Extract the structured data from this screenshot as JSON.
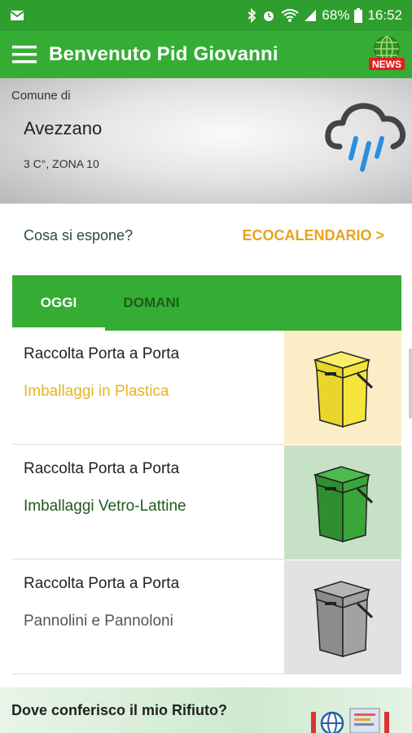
{
  "status_bar": {
    "battery": "68%",
    "time": "16:52",
    "left_icon": "mail-icon",
    "right_icons": [
      "bluetooth-icon",
      "alarm-icon",
      "wifi-icon",
      "signal-icon",
      "battery-icon"
    ]
  },
  "app_bar": {
    "title": "Benvenuto Pid Giovanni",
    "news_badge": "NEWS"
  },
  "weather": {
    "comune_label": "Comune di",
    "city": "Avezzano",
    "zone": "3 C°, ZONA 10",
    "icon": "rain-cloud-icon"
  },
  "links": {
    "question": "Cosa si espone?",
    "calendar": "ECOCALENDARIO >"
  },
  "tabs": [
    {
      "label": "OGGI",
      "active": true
    },
    {
      "label": "DOMANI",
      "active": false
    }
  ],
  "collections": [
    {
      "title": "Raccolta Porta a Porta",
      "type": "Imballaggi in Plastica",
      "type_color": "#e6b422",
      "bin_color": "#f2e33a",
      "bin_bg": "#fbeec7"
    },
    {
      "title": "Raccolta Porta a Porta",
      "type": "Imballaggi Vetro-Lattine",
      "type_color": "#1f5a1f",
      "bin_color": "#35a035",
      "bin_bg": "#c7e1c7"
    },
    {
      "title": "Raccolta Porta a Porta",
      "type": "Pannolini e Pannoloni",
      "type_color": "#555555",
      "bin_color": "#9a9a9a",
      "bin_bg": "#e2e2e2"
    }
  ],
  "bottom": {
    "title": "Dove conferisco il mio Rifiuto?"
  },
  "colors": {
    "primary": "#35ad35",
    "accent": "#e6a31f"
  }
}
